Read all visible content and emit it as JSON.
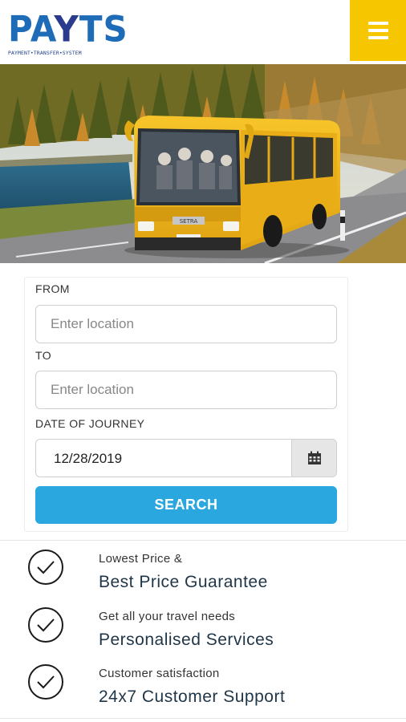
{
  "header": {
    "logo_text_pa": "PA",
    "logo_text_y": "Y",
    "logo_text_ts": "TS",
    "logo_tagline": "PAYMENT•TRANSFER•SYSTEM",
    "menu_icon": "hamburger-menu-icon",
    "accent_color": "#f6c700"
  },
  "hero": {
    "image": "yellow-bus-on-mountain-road",
    "bus_color": "#f2b81c"
  },
  "search": {
    "from_label": "FROM",
    "from_placeholder": "Enter location",
    "to_label": "TO",
    "to_placeholder": "Enter location",
    "date_label": "DATE OF JOURNEY",
    "date_value": "12/28/2019",
    "calendar_icon": "calendar-icon",
    "search_label": "SEARCH",
    "button_color": "#2ba7df"
  },
  "features": [
    {
      "icon": "check-circle-icon",
      "subtitle": "Lowest Price &",
      "title": "Best Price Guarantee"
    },
    {
      "icon": "check-circle-icon",
      "subtitle": "Get all your travel needs",
      "title": "Personalised Services"
    },
    {
      "icon": "check-circle-icon",
      "subtitle": "Customer satisfaction",
      "title": "24x7 Customer Support"
    }
  ]
}
